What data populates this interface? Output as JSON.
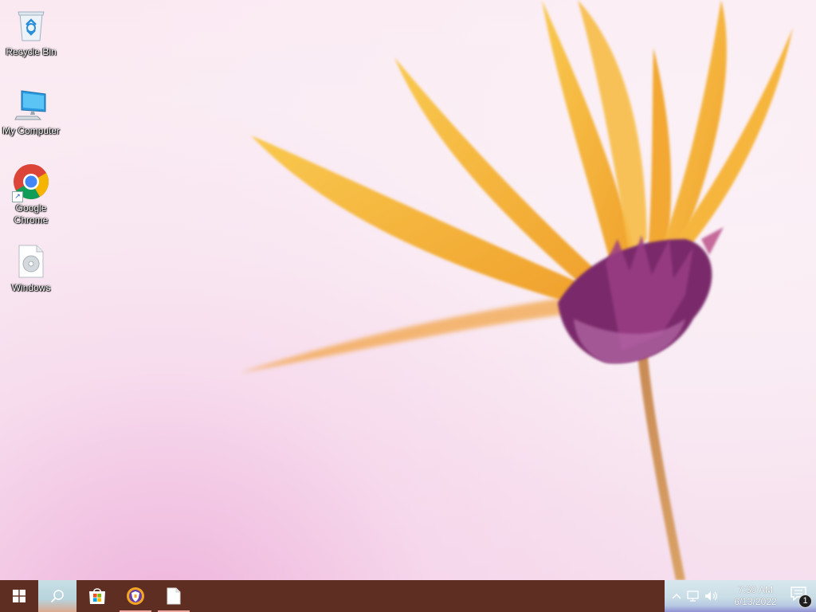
{
  "desktop": {
    "icons": [
      {
        "label": "Recycle Bin",
        "icon": "recycle-bin-icon"
      },
      {
        "label": "My Computer",
        "icon": "computer-icon"
      },
      {
        "label": "Google Chrome",
        "icon": "chrome-icon"
      },
      {
        "label": "Windows",
        "icon": "disc-file-icon"
      }
    ]
  },
  "taskbar": {
    "start_icon": "windows-logo-icon",
    "search_icon": "search-icon",
    "apps": [
      {
        "name": "Microsoft Store",
        "icon": "store-icon"
      },
      {
        "name": "Browser",
        "icon": "browser-shield-icon"
      },
      {
        "name": "File",
        "icon": "document-icon"
      }
    ],
    "tray": {
      "icons": [
        "chevron-up-icon",
        "network-icon",
        "volume-icon"
      ],
      "time": "7:30 AM",
      "date": "6/13/2022",
      "notification_count": "1"
    }
  },
  "colors": {
    "taskbar_bg": "#5e2e22",
    "petal": "#f5b23e",
    "flower_center": "#7a2a6a"
  }
}
